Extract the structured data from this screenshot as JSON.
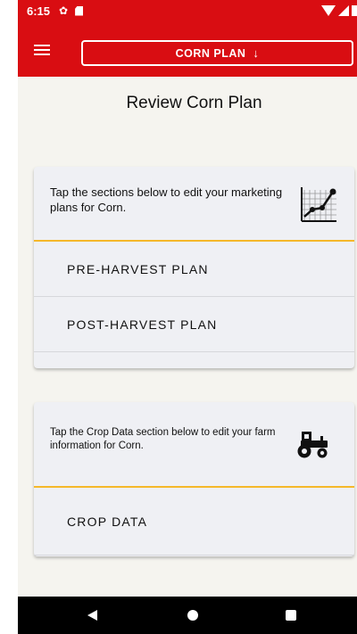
{
  "status_bar": {
    "time": "6:15"
  },
  "header": {
    "plan_selector_label": "CORN PLAN",
    "plan_selector_arrow": "↓"
  },
  "page": {
    "title": "Review Corn Plan"
  },
  "marketing_card": {
    "intro": "Tap the sections below to edit your marketing plans for Corn.",
    "icon": "chart-icon",
    "items": [
      {
        "label": "PRE-HARVEST PLAN"
      },
      {
        "label": "POST-HARVEST PLAN"
      }
    ]
  },
  "crop_card": {
    "intro": "Tap the Crop Data section below to edit your farm information for Corn.",
    "icon": "tractor-icon",
    "items": [
      {
        "label": "CROP DATA"
      }
    ]
  },
  "colors": {
    "brand_red": "#d90d12",
    "accent_yellow": "#f5b82a",
    "card_bg": "#eff0f4",
    "page_bg": "#f5f4ef"
  }
}
